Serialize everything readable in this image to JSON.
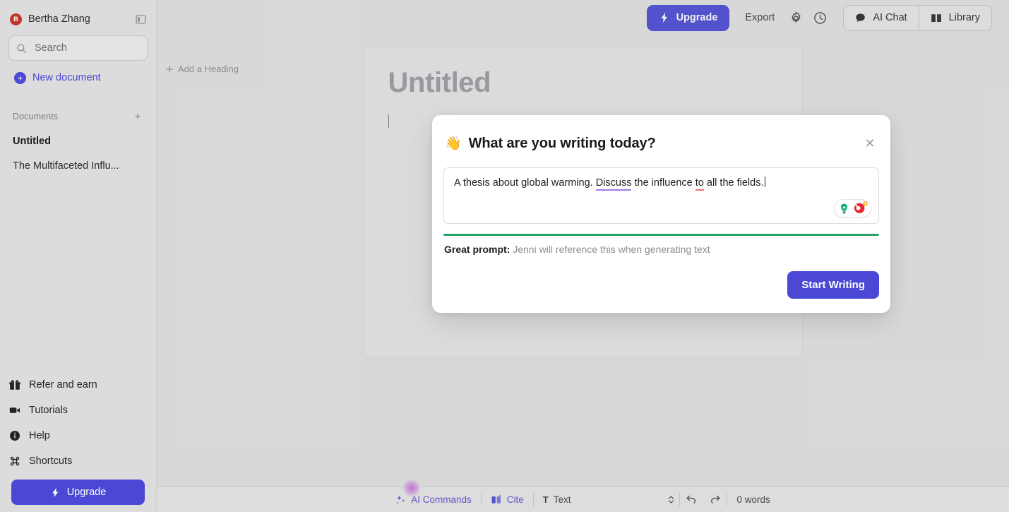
{
  "sidebar": {
    "user": {
      "name": "Bertha Zhang",
      "initial": "B",
      "avatar_color": "#c0392b"
    },
    "collapse_icon": "sidebar-toggle-icon",
    "search": {
      "placeholder": "Search",
      "value": ""
    },
    "new_document_label": "New document",
    "documents_section": {
      "title": "Documents",
      "add_label": "+"
    },
    "documents": [
      {
        "label": "Untitled",
        "active": true
      },
      {
        "label": "The Multifaceted Influ...",
        "active": false
      }
    ],
    "links": [
      {
        "label": "Refer and earn",
        "icon": "gift-icon"
      },
      {
        "label": "Tutorials",
        "icon": "video-camera-icon"
      },
      {
        "label": "Help",
        "icon": "info-circle-icon"
      },
      {
        "label": "Shortcuts",
        "icon": "command-key-icon"
      }
    ],
    "upgrade_label": "Upgrade"
  },
  "topbar": {
    "upgrade_label": "Upgrade",
    "export_label": "Export",
    "settings_icon": "gear-icon",
    "history_icon": "clock-icon",
    "ai_chat_label": "AI Chat",
    "library_label": "Library"
  },
  "document": {
    "add_heading_label": "Add a Heading",
    "title": "Untitled"
  },
  "modal": {
    "title": "What are you writing today?",
    "emoji": "👋",
    "close_label": "✕",
    "prompt": {
      "segment_1": "A thesis about global warming. ",
      "segment_grammar": "Discuss",
      "segment_2": " the influence ",
      "segment_spell": "to",
      "segment_3": " all the fields."
    },
    "badges": {
      "left_icon": "grammarly-lightbulb-icon",
      "right_icon": "grammarly-premium-icon"
    },
    "progress_percent": 100,
    "progress_color": "#2aa36b",
    "hint_bold": "Great prompt:",
    "hint_rest": " Jenni will reference this when generating text",
    "start_button_label": "Start Writing"
  },
  "statusbar": {
    "ai_commands_label": "AI Commands",
    "cite_label": "Cite",
    "text_style_prefix": "T",
    "text_style_label": "Text",
    "undo_icon": "undo-arrow-icon",
    "redo_icon": "redo-arrow-icon",
    "word_count": "0 words"
  },
  "colors": {
    "accent": "#4a48d4",
    "purple_accent": "#5b4fd0",
    "success": "#2aa36b",
    "sidebar_bg": "#dcdcdc",
    "canvas_bg": "#e3e3e3"
  }
}
